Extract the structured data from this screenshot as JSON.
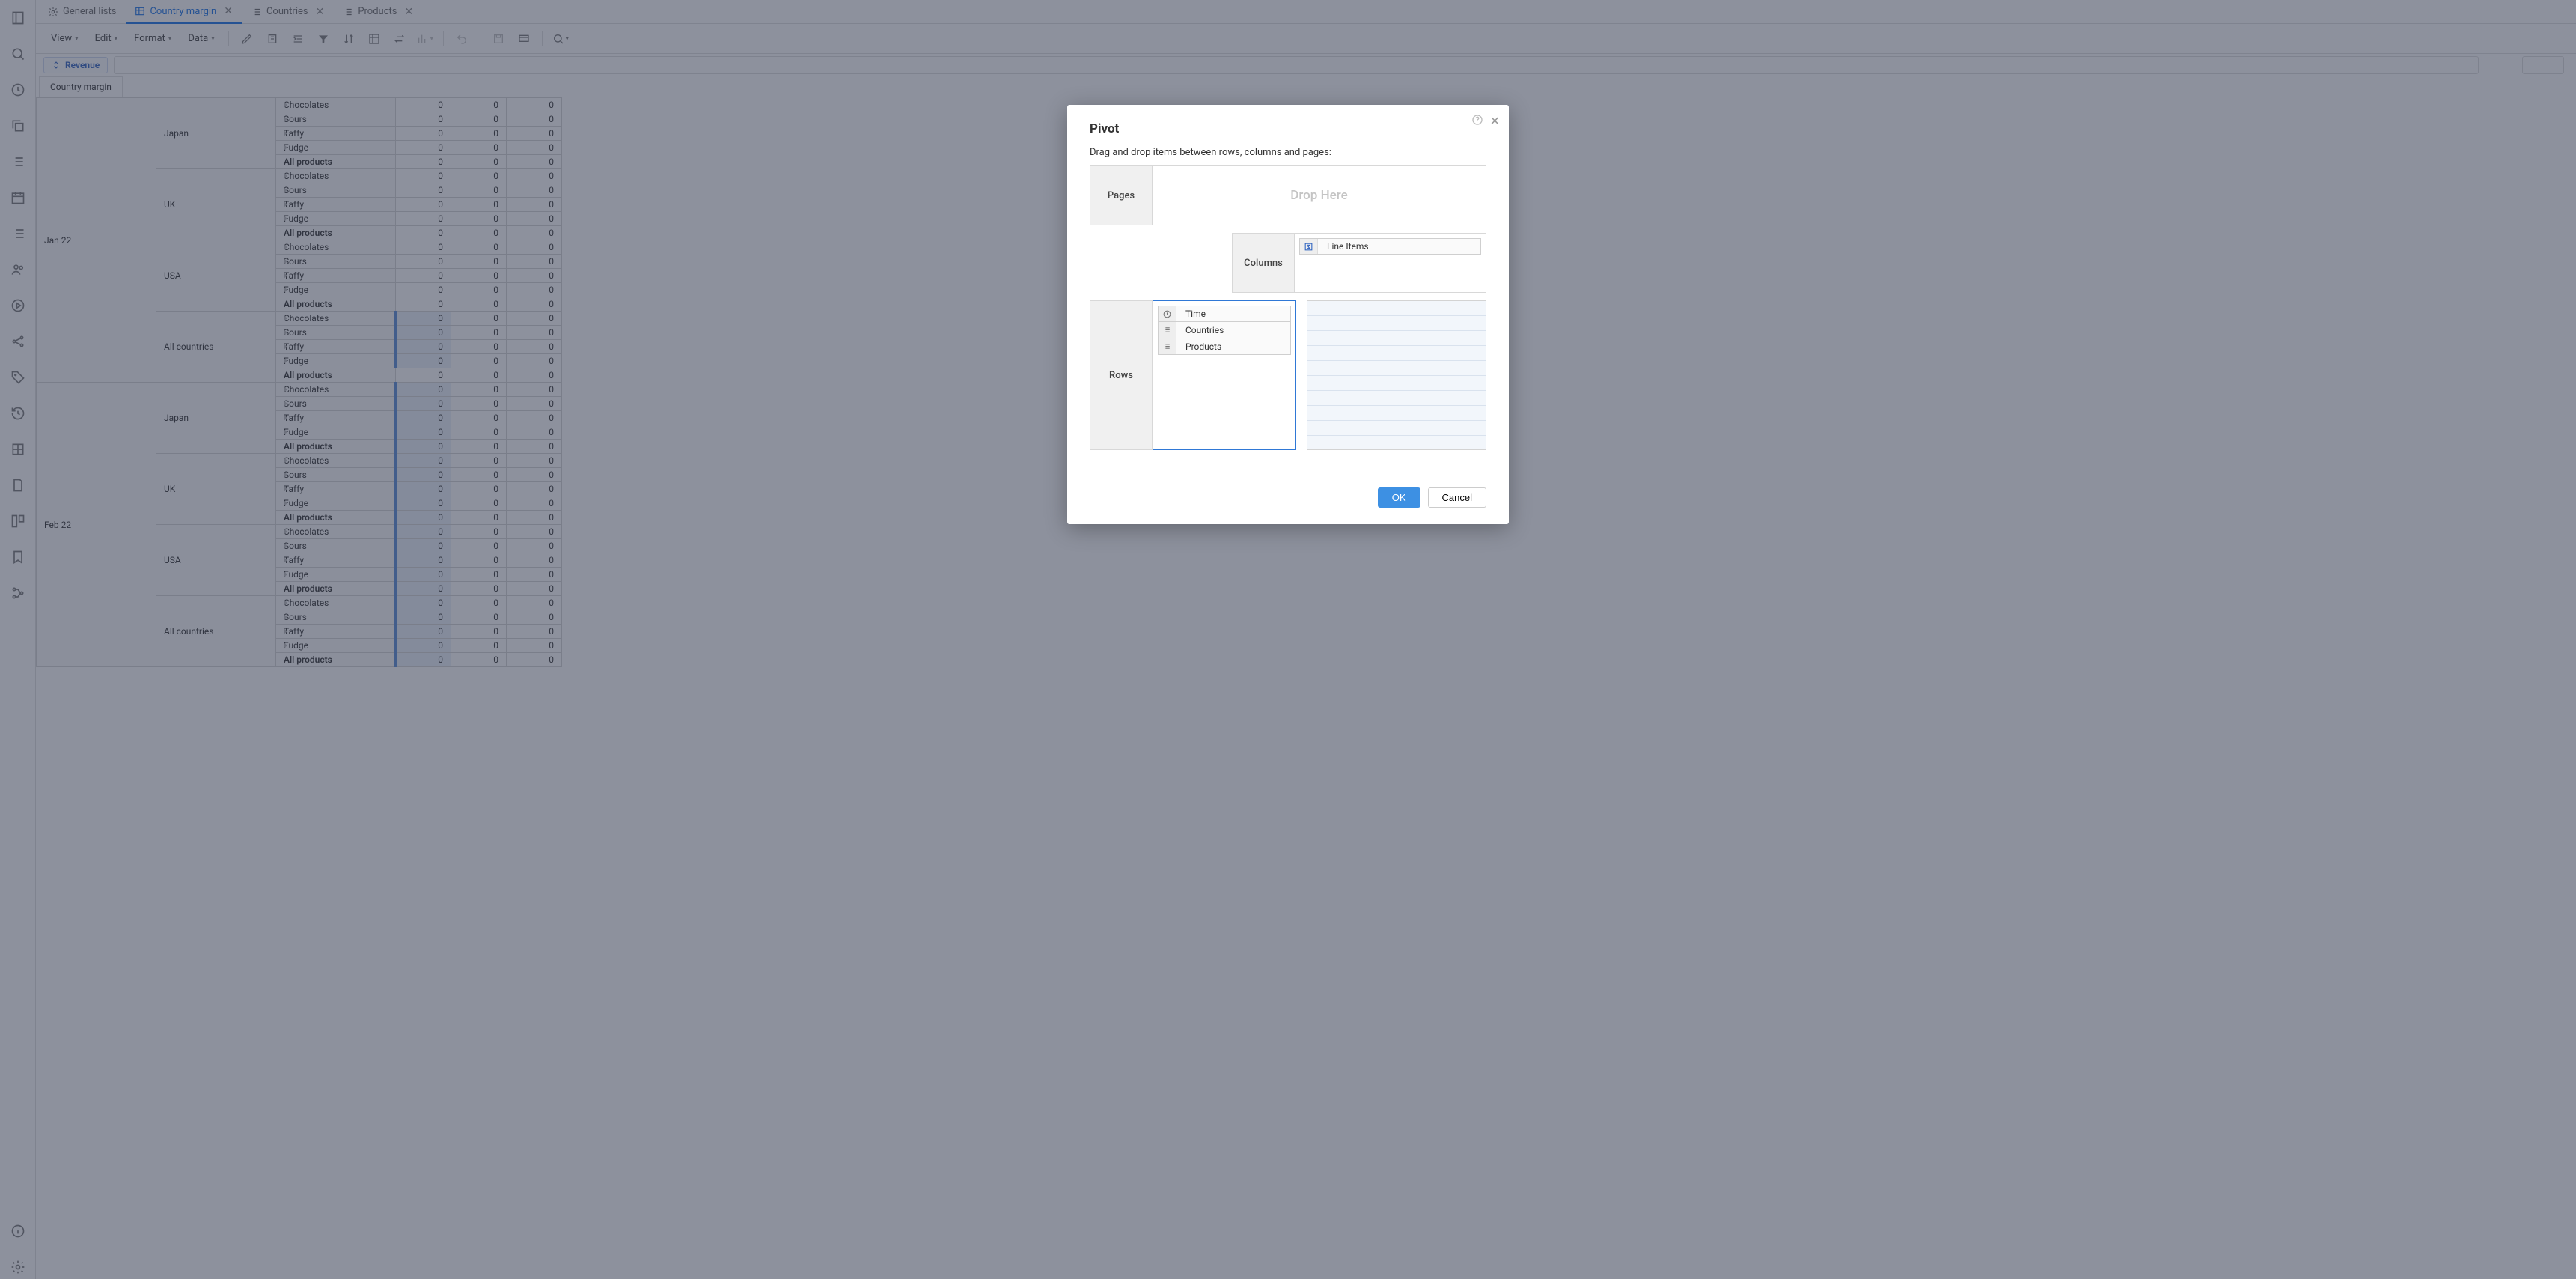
{
  "tabs": {
    "general": "General lists",
    "country_margin": "Country margin",
    "countries": "Countries",
    "products": "Products"
  },
  "menu": {
    "view": "View",
    "edit": "Edit",
    "format": "Format",
    "data": "Data"
  },
  "context": {
    "revenue_label": "Revenue"
  },
  "sheet_tab": "Country margin",
  "time_periods": [
    "Jan 22",
    "Feb 22"
  ],
  "countries": [
    "Japan",
    "UK",
    "USA",
    "All countries"
  ],
  "products": [
    "Chocolates",
    "Sours",
    "Taffy",
    "Fudge"
  ],
  "all_products_label": "All products",
  "data_value": "0",
  "modal": {
    "title": "Pivot",
    "subtitle": "Drag and drop items between rows, columns and pages:",
    "pages_label": "Pages",
    "drop_here": "Drop Here",
    "columns_label": "Columns",
    "line_items": "Line Items",
    "rows_label": "Rows",
    "row_dims": {
      "time": "Time",
      "countries": "Countries",
      "products": "Products"
    },
    "ok": "OK",
    "cancel": "Cancel"
  }
}
